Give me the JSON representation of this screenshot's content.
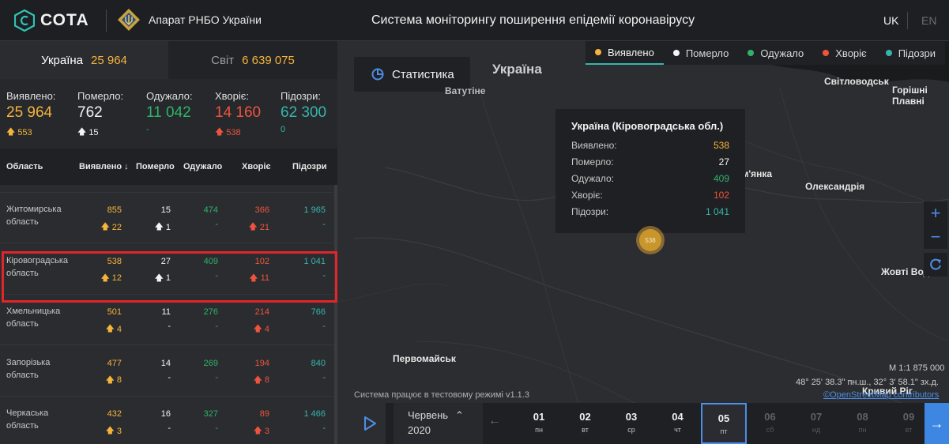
{
  "header": {
    "logo_text": "СОТА",
    "org_name": "Апарат РНБО України",
    "title": "Система моніторингу поширення епідемії коронавірусу",
    "lang_uk": "UK",
    "lang_en": "EN"
  },
  "scope": {
    "ukraine_label": "Україна",
    "ukraine_value": "25 964",
    "world_label": "Світ",
    "world_value": "6 639 075"
  },
  "totals": {
    "detected_label": "Виявлено:",
    "detected_value": "25 964",
    "detected_delta": "553",
    "died_label": "Померло:",
    "died_value": "762",
    "died_delta": "15",
    "recovered_label": "Одужало:",
    "recovered_value": "11 042",
    "recovered_delta": "-",
    "sick_label": "Хворіє:",
    "sick_value": "14 160",
    "sick_delta": "538",
    "suspected_label": "Підозри:",
    "suspected_value": "62 300",
    "suspected_delta": "0"
  },
  "table": {
    "headers": {
      "region": "Область",
      "detected": "Виявлено",
      "died": "Померло",
      "recovered": "Одужало",
      "sick": "Хворіє",
      "suspected": "Підозри"
    },
    "rows": [
      {
        "name": "Житомирська область",
        "detected": "855",
        "detected_d": "22",
        "died": "15",
        "died_d": "1",
        "recovered": "474",
        "recovered_d": "-",
        "sick": "366",
        "sick_d": "21",
        "suspected": "1 965",
        "suspected_d": "-"
      },
      {
        "name": "Кіровоградська область",
        "detected": "538",
        "detected_d": "12",
        "died": "27",
        "died_d": "1",
        "recovered": "409",
        "recovered_d": "-",
        "sick": "102",
        "sick_d": "11",
        "suspected": "1 041",
        "suspected_d": "-"
      },
      {
        "name": "Хмельницька область",
        "detected": "501",
        "detected_d": "4",
        "died": "11",
        "died_d": "-",
        "recovered": "276",
        "recovered_d": "-",
        "sick": "214",
        "sick_d": "4",
        "suspected": "766",
        "suspected_d": "-"
      },
      {
        "name": "Запорізька область",
        "detected": "477",
        "detected_d": "8",
        "died": "14",
        "died_d": "-",
        "recovered": "269",
        "recovered_d": "-",
        "sick": "194",
        "sick_d": "8",
        "suspected": "840",
        "suspected_d": "-"
      },
      {
        "name": "Черкаська область",
        "detected": "432",
        "detected_d": "3",
        "died": "16",
        "died_d": "-",
        "recovered": "327",
        "recovered_d": "-",
        "sick": "89",
        "sick_d": "3",
        "suspected": "1 466",
        "suspected_d": "-"
      }
    ]
  },
  "map": {
    "stats_button": "Статистика",
    "legend": [
      "Виявлено",
      "Померло",
      "Одужало",
      "Хворіє",
      "Підозри"
    ],
    "places": {
      "ukraine": "Україна",
      "vatutine": "Ватутіне",
      "svitlovodsk": "Світловодськ",
      "horishni": "Горішні Плавні",
      "znamianka": "Знам'янка",
      "oleksandriia": "Олександрія",
      "zhovti_vody": "Жовті Води",
      "pervomaisk": "Первомайськ",
      "kryvyi_rih": "Кривий Ріг"
    },
    "tooltip": {
      "title": "Україна (Кіровоградська обл.)",
      "rows": [
        {
          "label": "Виявлено:",
          "value": "538"
        },
        {
          "label": "Померло:",
          "value": "27"
        },
        {
          "label": "Одужало:",
          "value": "409"
        },
        {
          "label": "Хворіє:",
          "value": "102"
        },
        {
          "label": "Підозри:",
          "value": "1 041"
        }
      ]
    },
    "marker_label": "538",
    "scale": "M 1:1 875 000",
    "coords": "48° 25' 38.3\" пн.ш., 32° 3' 58.1\" зх.д.",
    "attribution": "©OpenStreetMap contributors",
    "test_note": "Система працює в тестовому режимі v1.1.3"
  },
  "timeline": {
    "month": "Червень",
    "year": "2020",
    "days": [
      {
        "num": "01",
        "wd": "пн"
      },
      {
        "num": "02",
        "wd": "вт"
      },
      {
        "num": "03",
        "wd": "ср"
      },
      {
        "num": "04",
        "wd": "чт"
      },
      {
        "num": "05",
        "wd": "пт"
      },
      {
        "num": "06",
        "wd": "сб"
      },
      {
        "num": "07",
        "wd": "нд"
      },
      {
        "num": "08",
        "wd": "пн"
      },
      {
        "num": "09",
        "wd": "вт"
      }
    ]
  },
  "colors": {
    "detected": "#f6b43c",
    "died": "#f4f4f4",
    "recovered": "#2fb36a",
    "sick": "#f0533d",
    "suspected": "#36b5ad",
    "accent": "#4d8ee6"
  }
}
